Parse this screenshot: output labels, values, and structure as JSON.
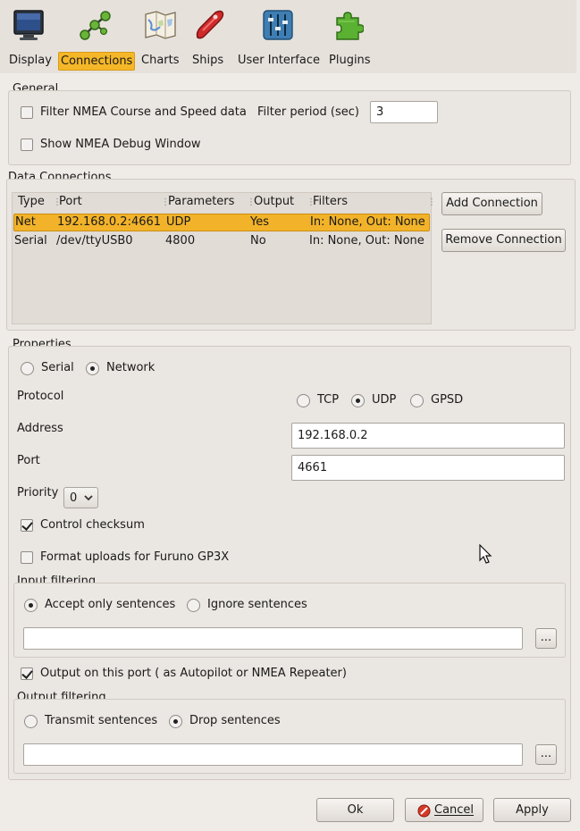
{
  "toolbar": {
    "tabs": [
      {
        "label": "Display",
        "icon": "monitor-icon"
      },
      {
        "label": "Connections",
        "icon": "connections-icon"
      },
      {
        "label": "Charts",
        "icon": "charts-icon"
      },
      {
        "label": "Ships",
        "icon": "ship-icon"
      },
      {
        "label": "User Interface",
        "icon": "sliders-icon"
      },
      {
        "label": "Plugins",
        "icon": "puzzle-icon"
      }
    ],
    "active_tab": "Connections"
  },
  "general": {
    "title": "General",
    "filter_nmea_label": "Filter NMEA Course and Speed data",
    "filter_nmea_checked": false,
    "filter_period_label": "Filter period (sec)",
    "filter_period_value": "3",
    "show_debug_label": "Show NMEA Debug Window",
    "show_debug_checked": false
  },
  "data_connections": {
    "title": "Data Connections",
    "columns": [
      "Type",
      "Port",
      "Parameters",
      "Output",
      "Filters"
    ],
    "rows": [
      {
        "type": "Net",
        "port": "192.168.0.2:4661",
        "parameters": "UDP",
        "output": "Yes",
        "filters": "In: None, Out: None",
        "selected": true
      },
      {
        "type": "Serial",
        "port": "/dev/ttyUSB0",
        "parameters": "4800",
        "output": "No",
        "filters": "In: None, Out: None",
        "selected": false
      }
    ],
    "add_button": "Add Connection",
    "remove_button": "Remove Connection"
  },
  "properties": {
    "title": "Properties",
    "mode_serial_label": "Serial",
    "mode_network_label": "Network",
    "mode_selected": "Network",
    "protocol_label": "Protocol",
    "protocol_options": [
      "TCP",
      "UDP",
      "GPSD"
    ],
    "protocol_selected": "UDP",
    "address_label": "Address",
    "address_value": "192.168.0.2",
    "port_label": "Port",
    "port_value": "4661",
    "priority_label": "Priority",
    "priority_value": "0",
    "control_checksum_label": "Control checksum",
    "control_checksum_checked": true,
    "furuno_label": "Format uploads for Furuno GP3X",
    "furuno_checked": false,
    "input_filtering": {
      "title": "Input filtering",
      "accept_label": "Accept only sentences",
      "ignore_label": "Ignore sentences",
      "selected": "accept",
      "sentences_value": "",
      "browse_label": "..."
    },
    "output_on_port_label": "Output on this port ( as Autopilot or NMEA Repeater)",
    "output_on_port_checked": true,
    "output_filtering": {
      "title": "Output filtering",
      "transmit_label": "Transmit sentences",
      "drop_label": "Drop sentences",
      "selected": "drop",
      "sentences_value": "",
      "browse_label": "..."
    }
  },
  "footer": {
    "ok_label": "Ok",
    "cancel_label": "Cancel",
    "apply_label": "Apply"
  },
  "colors": {
    "accent": "#f2b32a",
    "background": "#efebe7"
  }
}
